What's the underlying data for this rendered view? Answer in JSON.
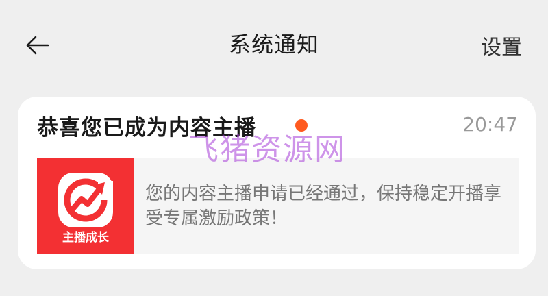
{
  "header": {
    "title": "系统通知",
    "settings_label": "设置",
    "back_icon": "back-arrow-icon"
  },
  "notification": {
    "title": "恭喜您已成为内容主播",
    "time": "20:47",
    "unread": true,
    "unread_color": "#ff5a1f",
    "thumbnail": {
      "label": "主播成长",
      "icon": "growth-arrow-icon",
      "color": "#f33033"
    },
    "message": "您的内容主播申请已经通过，保持稳定开播享受专属激励政策！"
  },
  "watermark": "飞猪资源网"
}
